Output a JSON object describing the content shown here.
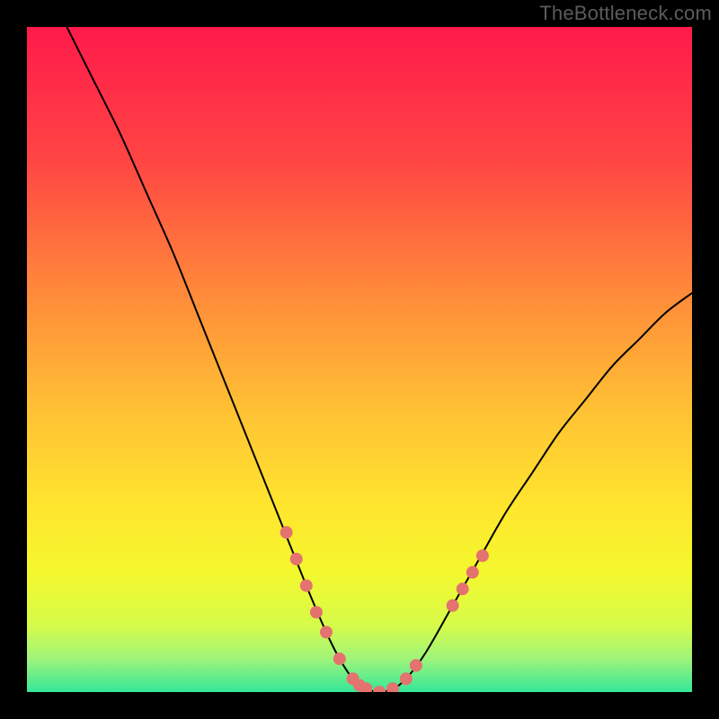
{
  "watermark": "TheBottleneck.com",
  "chart_data": {
    "type": "line",
    "title": "",
    "xlabel": "",
    "ylabel": "",
    "xlim": [
      0,
      100
    ],
    "ylim": [
      0,
      100
    ],
    "grid": false,
    "legend": false,
    "background": {
      "type": "vertical-gradient",
      "stops": [
        {
          "pos": 0.0,
          "color": "#ff1a4b"
        },
        {
          "pos": 0.2,
          "color": "#ff4543"
        },
        {
          "pos": 0.4,
          "color": "#ff8a3a"
        },
        {
          "pos": 0.58,
          "color": "#ffc234"
        },
        {
          "pos": 0.72,
          "color": "#ffe52e"
        },
        {
          "pos": 0.82,
          "color": "#f4f82d"
        },
        {
          "pos": 0.9,
          "color": "#d6fb4a"
        },
        {
          "pos": 0.95,
          "color": "#9ff47a"
        },
        {
          "pos": 1.0,
          "color": "#34e79a"
        }
      ]
    },
    "series": [
      {
        "name": "bottleneck-curve",
        "color": "#000000",
        "width": 2,
        "x": [
          6,
          10,
          14,
          18,
          22,
          26,
          30,
          34,
          38,
          42,
          45,
          47,
          49,
          51,
          53,
          55,
          57,
          60,
          64,
          68,
          72,
          76,
          80,
          84,
          88,
          92,
          96,
          100
        ],
        "y": [
          100,
          92,
          84,
          75,
          66,
          56,
          46,
          36,
          26,
          16,
          9,
          5,
          2,
          0.5,
          0,
          0.5,
          2,
          6,
          13,
          20,
          27,
          33,
          39,
          44,
          49,
          53,
          57,
          60
        ]
      }
    ],
    "markers": {
      "name": "highlight-dots",
      "color": "#e4726f",
      "radius": 7,
      "points": [
        {
          "x": 39,
          "y": 24
        },
        {
          "x": 40.5,
          "y": 20
        },
        {
          "x": 42,
          "y": 16
        },
        {
          "x": 43.5,
          "y": 12
        },
        {
          "x": 45,
          "y": 9
        },
        {
          "x": 47,
          "y": 5
        },
        {
          "x": 49,
          "y": 2
        },
        {
          "x": 50,
          "y": 1
        },
        {
          "x": 51,
          "y": 0.5
        },
        {
          "x": 53,
          "y": 0
        },
        {
          "x": 55,
          "y": 0.5
        },
        {
          "x": 57,
          "y": 2
        },
        {
          "x": 58.5,
          "y": 4
        },
        {
          "x": 64,
          "y": 13
        },
        {
          "x": 65.5,
          "y": 15.5
        },
        {
          "x": 67,
          "y": 18
        },
        {
          "x": 68.5,
          "y": 20.5
        }
      ]
    }
  }
}
